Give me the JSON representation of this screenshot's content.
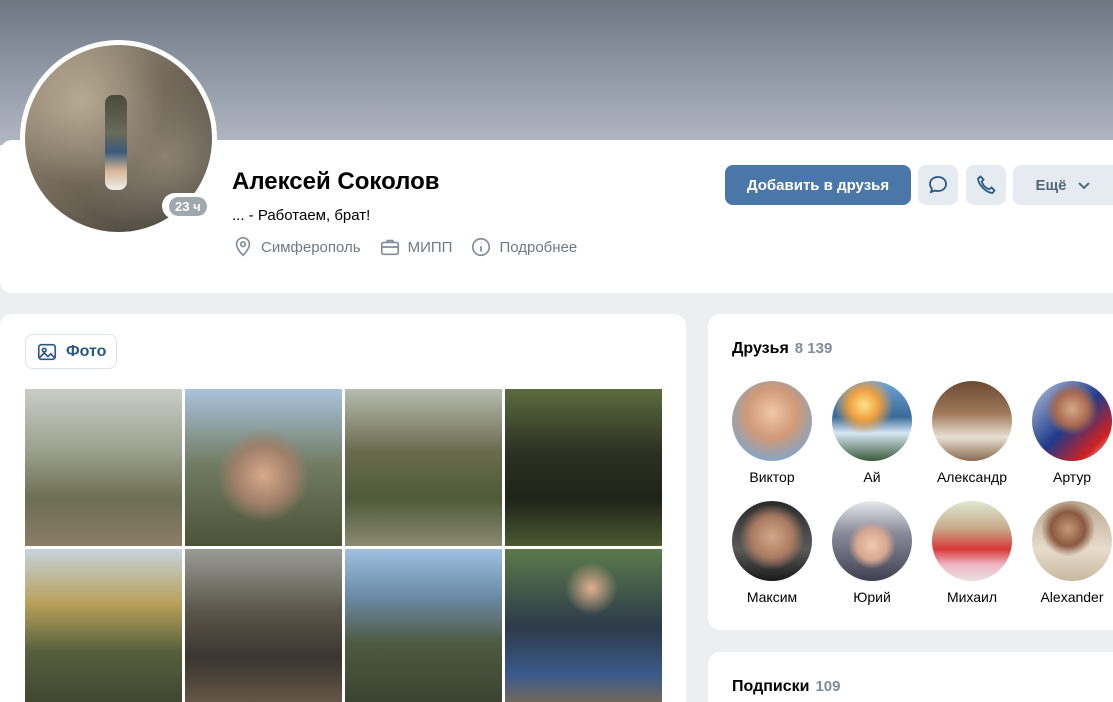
{
  "profile": {
    "name": "Алексей Соколов",
    "status": "... - Работаем, брат!",
    "last_seen": "23 ч",
    "city": "Симферополь",
    "work": "МИПП",
    "details": "Подробнее"
  },
  "actions": {
    "add_friend": "Добавить в друзья",
    "more": "Ещё"
  },
  "photos": {
    "tab_label": "Фото"
  },
  "friends": {
    "title": "Друзья",
    "count": "8 139",
    "items": [
      {
        "name": "Виктор"
      },
      {
        "name": "Ай"
      },
      {
        "name": "Александр"
      },
      {
        "name": "Артур"
      },
      {
        "name": "Максим"
      },
      {
        "name": "Юрий"
      },
      {
        "name": "Михаил"
      },
      {
        "name": "Alexander"
      }
    ]
  },
  "subscriptions": {
    "title": "Подписки",
    "count": "109"
  },
  "colors": {
    "accent": "#4a76a8",
    "link": "#2a5885",
    "muted": "#818c99",
    "background": "#edeef0"
  }
}
